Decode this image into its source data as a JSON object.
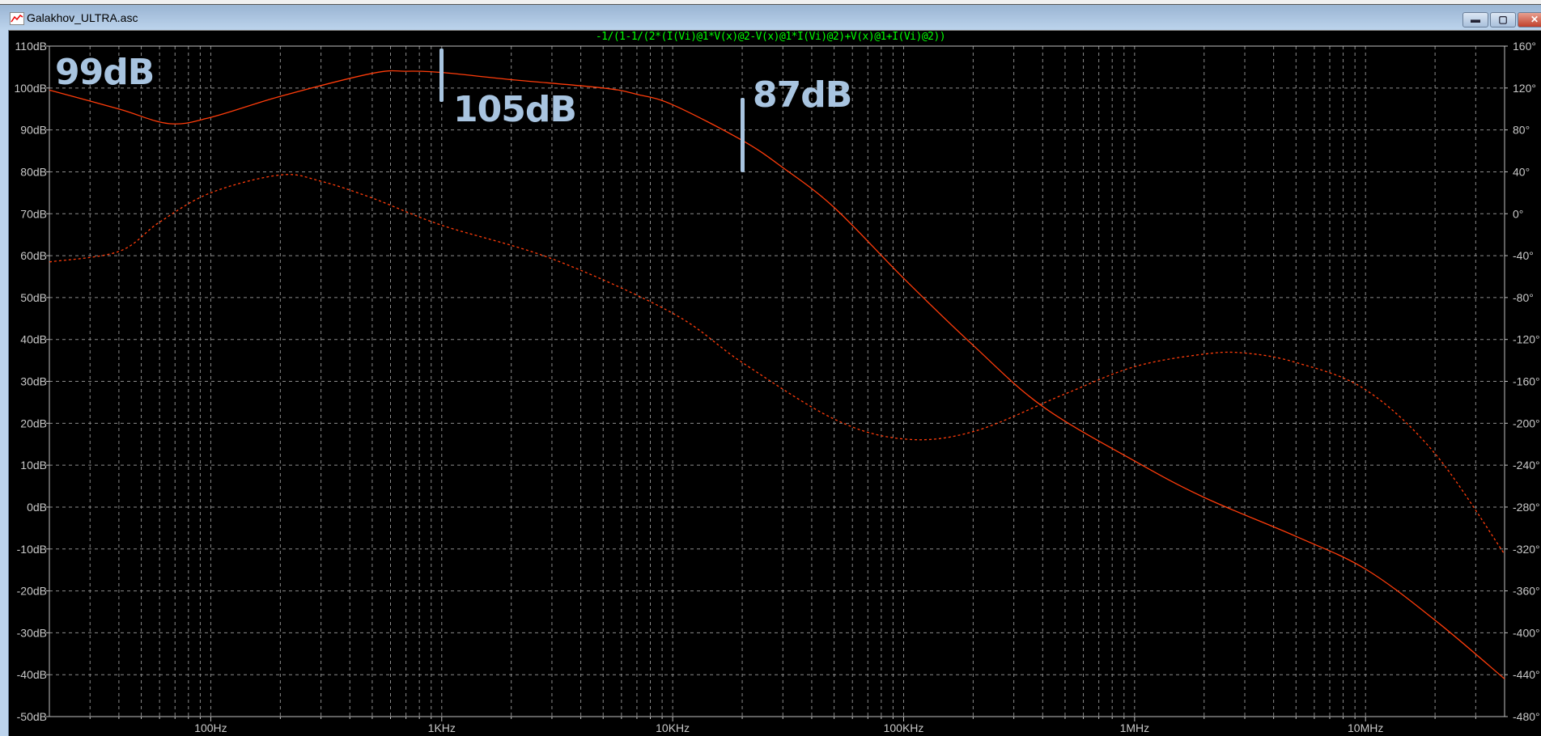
{
  "window": {
    "title": "Galakhov_ULTRA.asc",
    "icon": "waveform-icon",
    "buttons": {
      "minimize": "▬",
      "maximize": "▢",
      "close": "✕"
    }
  },
  "trace_label": "-1/(1-1/(2*(I(Vi)@1*V(x)@2-V(x)@1*I(Vi)@2)+V(x)@1+I(Vi)@2))",
  "annotations": [
    {
      "text": "99dB"
    },
    {
      "text": "105dB"
    },
    {
      "text": "87dB"
    }
  ],
  "colors": {
    "trace": "#ff3c0a",
    "grid": "#8c8c8c",
    "axis": "#c0c0c0",
    "label": "#c8c8c8",
    "annotation": "#a8c4e0",
    "title": "#00ff00"
  },
  "chart_data": {
    "type": "line",
    "title": "-1/(1-1/(2*(I(Vi)@1*V(x)@2-V(x)@1*I(Vi)@2)+V(x)@1+I(Vi)@2))",
    "xscale": "log",
    "xlim": [
      20,
      40000000
    ],
    "ylim_left": [
      -50,
      110
    ],
    "ylim_right": [
      -480,
      160
    ],
    "grid": true,
    "x_ticks": [
      {
        "value": 100,
        "label": "100Hz"
      },
      {
        "value": 1000,
        "label": "1KHz"
      },
      {
        "value": 10000,
        "label": "10KHz"
      },
      {
        "value": 100000,
        "label": "100KHz"
      },
      {
        "value": 1000000,
        "label": "1MHz"
      },
      {
        "value": 10000000,
        "label": "10MHz"
      }
    ],
    "y_left_ticks": [
      "110dB",
      "100dB",
      "90dB",
      "80dB",
      "70dB",
      "60dB",
      "50dB",
      "40dB",
      "30dB",
      "20dB",
      "10dB",
      "0dB",
      "-10dB",
      "-20dB",
      "-30dB",
      "-40dB",
      "-50dB"
    ],
    "y_left_values": [
      110,
      100,
      90,
      80,
      70,
      60,
      50,
      40,
      30,
      20,
      10,
      0,
      -10,
      -20,
      -30,
      -40,
      -50
    ],
    "y_right_ticks": [
      "160°",
      "120°",
      "80°",
      "40°",
      "0°",
      "-40°",
      "-80°",
      "-120°",
      "-160°",
      "-200°",
      "-240°",
      "-280°",
      "-320°",
      "-360°",
      "-400°",
      "-440°",
      "-480°"
    ],
    "series": [
      {
        "name": "magnitude",
        "axis": "left",
        "style": "solid",
        "x": [
          20,
          40,
          66,
          100,
          200,
          500,
          700,
          1000,
          2000,
          5000,
          7000,
          10000,
          20000,
          30000,
          50000,
          100000,
          200000,
          400000,
          1000000,
          2000000,
          5000000,
          10000000,
          20000000,
          40000000
        ],
        "y": [
          99.5,
          95,
          91.5,
          93,
          98,
          103.5,
          104,
          103.7,
          102,
          100,
          98.5,
          96,
          87.5,
          81,
          71.5,
          54.6,
          38.6,
          24,
          11,
          2.3,
          -7,
          -14.8,
          -27,
          -41
        ]
      },
      {
        "name": "phase",
        "axis": "right",
        "style": "dashed",
        "x": [
          20,
          40,
          60,
          100,
          200,
          300,
          500,
          1000,
          3000,
          10000,
          20000,
          50000,
          100000,
          200000,
          500000,
          1000000,
          2000000,
          3000000,
          5000000,
          10000000,
          20000000,
          40000000
        ],
        "y": [
          -46,
          -36,
          -8,
          20,
          37,
          31,
          15,
          -11,
          -43,
          -95,
          -142,
          -196,
          -215,
          -208,
          -172,
          -146,
          -134,
          -133,
          -142,
          -168,
          -229,
          -325
        ]
      }
    ]
  }
}
